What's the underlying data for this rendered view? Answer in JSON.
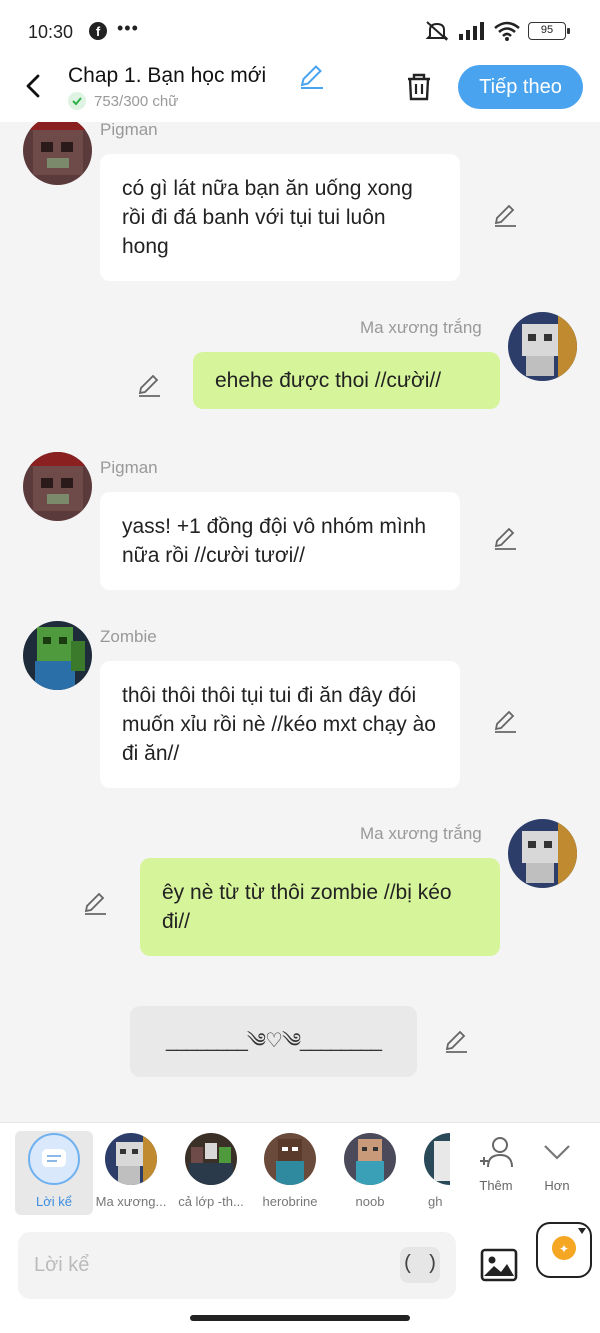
{
  "status_bar": {
    "time": "10:30",
    "fb_glyph": "f",
    "dots": "•••",
    "battery": "95"
  },
  "header": {
    "title": "Chap 1. Bạn học mới",
    "word_count": "753/300 chữ",
    "next_label": "Tiếp theo"
  },
  "messages": [
    {
      "sender": "Pigman",
      "side": "in",
      "text": "có gì lát nữa bạn ăn uống xong rồi đi đá banh với tụi tui luôn hong"
    },
    {
      "sender": "Ma xương trắng",
      "side": "out",
      "text": "ehehe được thoi //cười//"
    },
    {
      "sender": "Pigman",
      "side": "in",
      "text": "yass! +1 đồng đội vô nhóm mình nữa rồi //cười tươi//"
    },
    {
      "sender": "Zombie",
      "side": "in",
      "text": "thôi thôi thôi tụi tui đi ăn đây đói muốn xỉu rồi nè //kéo mxt chạy ào đi ăn//"
    },
    {
      "sender": "Ma xương trắng",
      "side": "out",
      "text": "êy nè từ từ thôi zombie //bị kéo đi//"
    }
  ],
  "divider": "________༄♡༄________",
  "characters": [
    {
      "label": "Lời kể"
    },
    {
      "label": "Ma xương..."
    },
    {
      "label": "cả lớp -th..."
    },
    {
      "label": "herobrine"
    },
    {
      "label": "noob"
    },
    {
      "label": "gh"
    }
  ],
  "more": {
    "add_label": "Thêm",
    "more_label": "Hơn"
  },
  "input": {
    "placeholder": "Lời kể",
    "paren": "( )"
  },
  "colors": {
    "accent": "#4aa3ee",
    "outgoing_bubble": "#d6f59a",
    "incoming_bubble": "#ffffff",
    "background": "#f4f4f4"
  }
}
